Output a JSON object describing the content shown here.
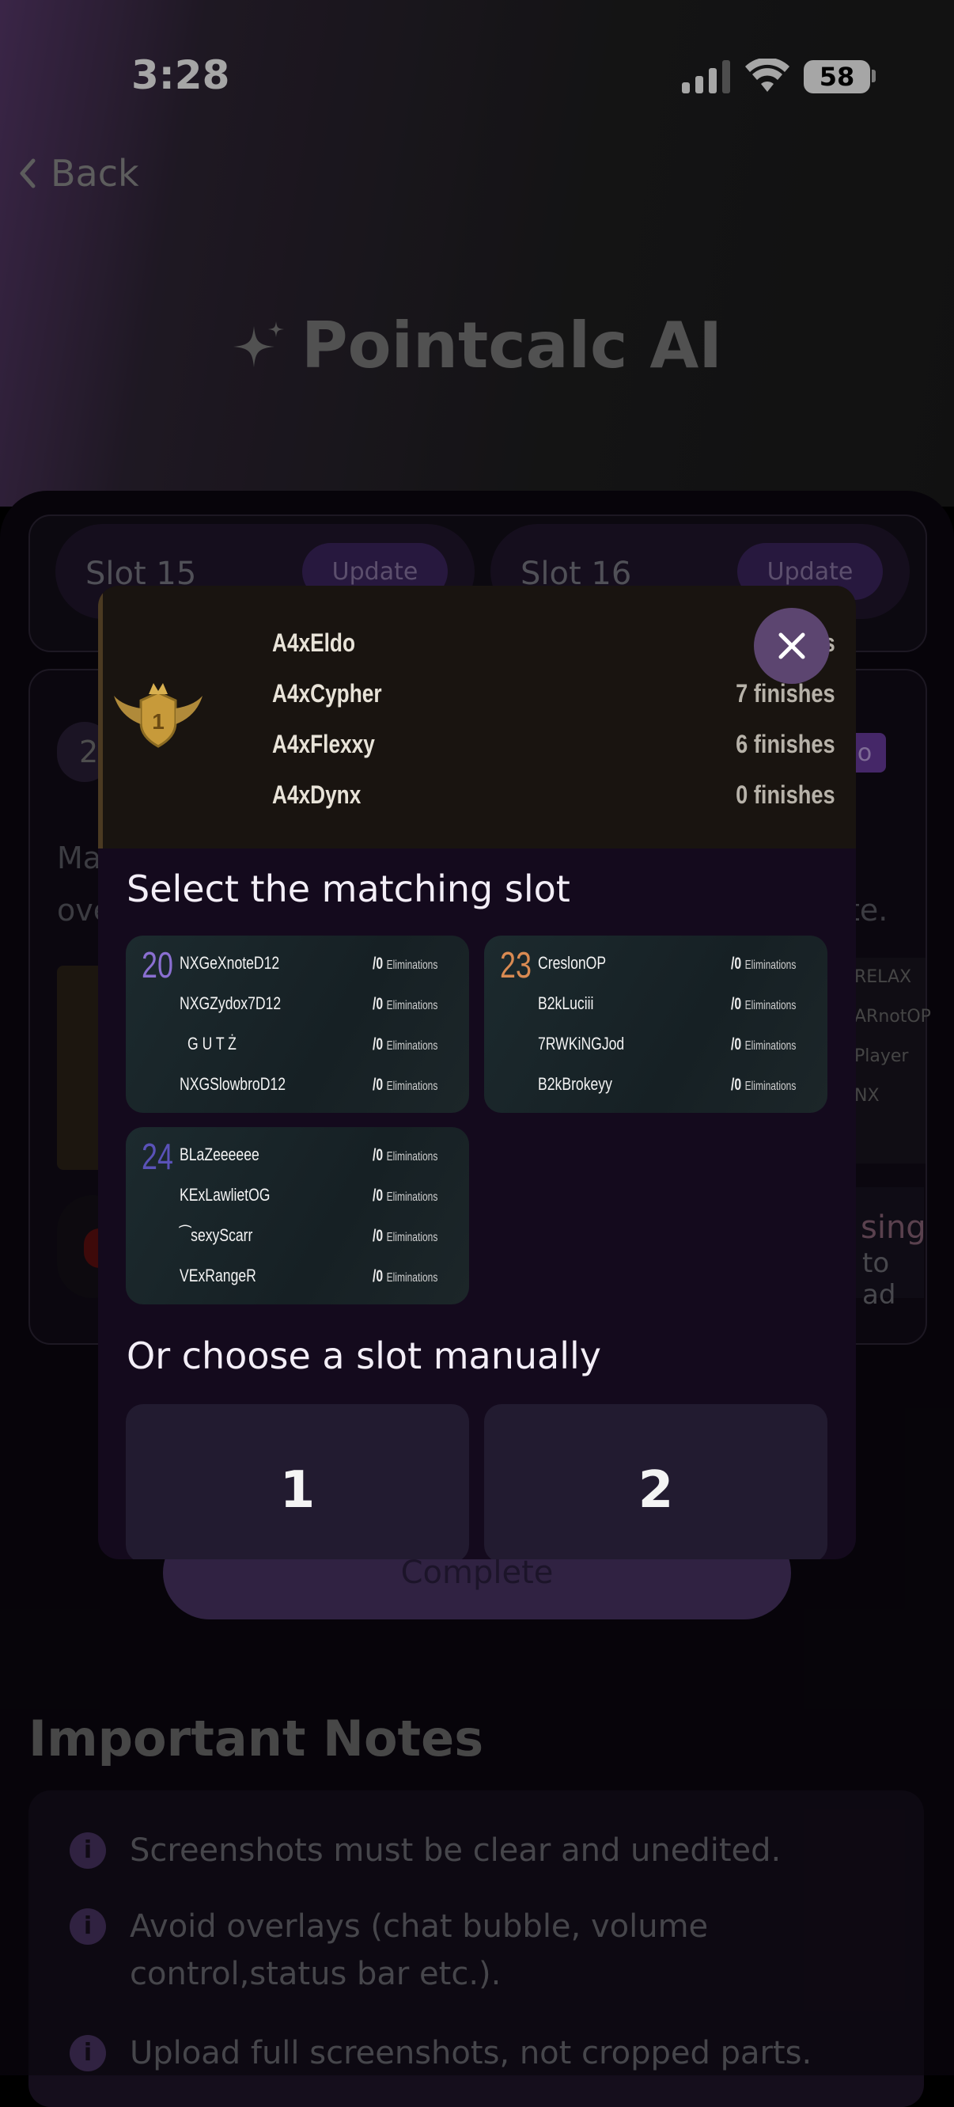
{
  "status_bar": {
    "time": "3:28",
    "battery": "58"
  },
  "nav": {
    "back_label": "Back"
  },
  "page": {
    "title": "Pointcalc AI"
  },
  "background": {
    "slots": [
      {
        "label": "Slot 15",
        "action": "Update"
      },
      {
        "label": "Slot 16",
        "action": "Update"
      }
    ],
    "chip_text": "2",
    "badge_text": "o",
    "line1_start": "Ma",
    "line2_start": "ove",
    "line2_end": "te.",
    "right_names": [
      "RELAX",
      "ARnotOP",
      "Player",
      "NX"
    ],
    "side_partial_1": "sing",
    "side_partial_2": "to ad",
    "complete_label": "Complete"
  },
  "notes": {
    "title": "Important Notes",
    "items": [
      "Screenshots must be clear and unedited.",
      "Avoid overlays (chat bubble, volume control,status bar etc.).",
      "Upload full screenshots, not cropped parts."
    ]
  },
  "modal": {
    "banner": {
      "players": [
        {
          "name": "A4xEldo",
          "finishes": ""
        },
        {
          "name": "A4xCypher",
          "finishes": "7 finishes"
        },
        {
          "name": "A4xFlexxy",
          "finishes": "6 finishes"
        },
        {
          "name": "A4xDynx",
          "finishes": "0 finishes"
        }
      ],
      "partial_first_finish": "s"
    },
    "select_title": "Select the matching slot",
    "match_slots": [
      {
        "number": "20",
        "number_color": "#8a6fd1",
        "players": [
          {
            "name": "NXGeXnoteD12",
            "elims": "/0",
            "elim_label": "Eliminations"
          },
          {
            "name": "NXGZydox7D12",
            "elims": "/0",
            "elim_label": "Eliminations"
          },
          {
            "name": "G U T Ż",
            "elims": "/0",
            "elim_label": "Eliminations"
          },
          {
            "name": "NXGSlowbroD12",
            "elims": "/0",
            "elim_label": "Eliminations"
          }
        ]
      },
      {
        "number": "23",
        "number_color": "#d98a52",
        "players": [
          {
            "name": "CreslonOP",
            "elims": "/0",
            "elim_label": "Eliminations"
          },
          {
            "name": "B2kLuciii",
            "elims": "/0",
            "elim_label": "Eliminations"
          },
          {
            "name": "7RWKiNGJod",
            "elims": "/0",
            "elim_label": "Eliminations"
          },
          {
            "name": "B2kBrokeyy",
            "elims": "/0",
            "elim_label": "Eliminations"
          }
        ]
      },
      {
        "number": "24",
        "number_color": "#5a52b8",
        "players": [
          {
            "name": "BLaZeeeeee",
            "elims": "/0",
            "elim_label": "Eliminations"
          },
          {
            "name": "KExLawlietOG",
            "elims": "/0",
            "elim_label": "Eliminations"
          },
          {
            "name": "⁀sexyScarr",
            "elims": "/0",
            "elim_label": "Eliminations"
          },
          {
            "name": "VExRangeR",
            "elims": "/0",
            "elim_label": "Eliminations"
          }
        ]
      }
    ],
    "manual_title": "Or choose a slot manually",
    "manual_slots": [
      "1",
      "2"
    ]
  },
  "colors": {
    "accent": "#5c4570",
    "primary_button": "#4a3566"
  }
}
